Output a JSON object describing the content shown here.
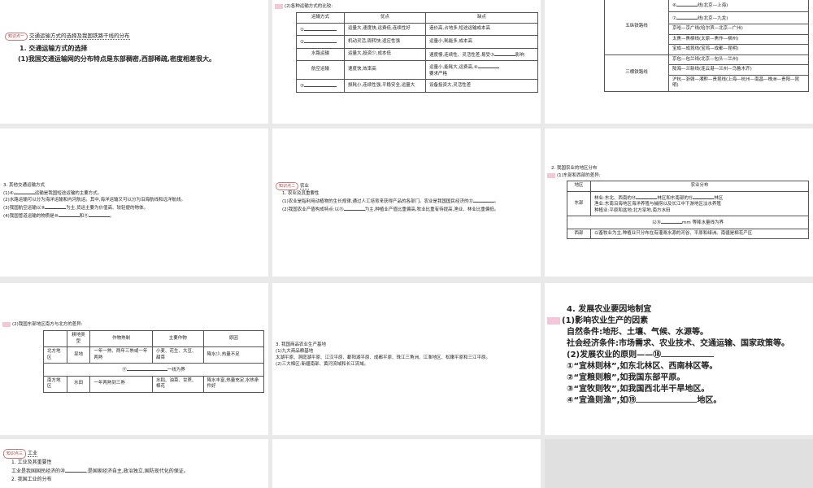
{
  "s1": {
    "tag": "知识点一",
    "title": "交通运输方式的选择及我国铁路干线的分布",
    "h": "1. 交通运输方式的选择",
    "p": "(1)我国交通运输网的分布特点是东部稠密,西部稀疏,密度相差很大。"
  },
  "s2": {
    "cap": "(2)各种运输方式的比较:",
    "head": [
      "运输方式",
      "优点",
      "缺点"
    ],
    "rows": [
      [
        "①",
        "运量大,速度快,运费低,连续性好",
        "造价高,占地多,短途运输成本高"
      ],
      [
        "②",
        "机动灵活,周转快,适应性强",
        "运量小,耗能多,成本高"
      ],
      [
        "水路运输",
        "运量大,投资少,成本低",
        "速度慢,连续性、灵活性差,易受③",
        "影响"
      ],
      [
        "航空运输",
        "速度快,效率高",
        "运量小,能耗大,运费高,④",
        "要求严格"
      ],
      [
        "⑤",
        "损耗小,连续性强,平稳安全,运量大",
        "设备投资大,灵活性差"
      ]
    ]
  },
  "s3": {
    "g1": "五纵铁路线",
    "g2": "三横铁路线",
    "l1": [
      "⑥",
      "线(北京—上海)",
      "⑦",
      "线(北京—九龙)",
      "京哈—京广线(哈尔滨—北京—广州)",
      "太焦—焦柳线(太原—焦作—柳州)",
      "宝成—成昆线(宝鸡—成都—昆明)"
    ],
    "l2": [
      "京包—包兰线(北京—包头—兰州)",
      "陇海—兰新线(连云港—兰州—乌鲁木齐)",
      "沪杭—浙赣—湘黔—贵昆线(上海—杭州—南昌—株洲—贵阳—昆明)"
    ]
  },
  "s4": {
    "h": "3. 其他交通运输方式",
    "l1a": "(1)⑥",
    "l1b": "运输是我国短途运输的主要方式。",
    "l2": "(2)水路运输可以分为海洋运输和内河航运。其中,海洋运输又可以分为沿海航线和远洋航线。",
    "l3a": "(3)我国航空运输以⑨",
    "l3b": "为主,货运主要为价值高、较轻便的物体。",
    "l4a": "(4)我国管道运输的物质是⑩",
    "l4b": "和⑪",
    "l4c": "。"
  },
  "s5": {
    "tag": "知识点二",
    "title": "农业",
    "h": "1. 农业及其重要性",
    "p1a": "(1)农业是指利用动植物的生长规律,通过人工培育来获得产品的各部门。农业是我国国民经济的⑫",
    "p1b": "。",
    "p2a": "(2)我国农业产值构成特点:以⑬",
    "p2b": "为主,种植业产值比重偏高,牧业比重有待提高,渔业、林业比重偏低。"
  },
  "s6": {
    "h": "2. 我国农业的地区分布",
    "cap": "(1)东部和西部的差异:",
    "head": [
      "地区",
      "农业分布"
    ],
    "east": "东部",
    "e1a": "林业:东北、西南的⑭",
    "e1b": "林区和东南部的⑮",
    "e1c": "林区",
    "e2": "渔业:东南沿海地区海洋养殖与捕捞以及长江中下游地区淡水养殖",
    "e3": "种植业:平原和盆地;北方旱地,南方水田",
    "divA": "以⑯",
    "divB": "mm 等降水量线为界",
    "west": "西部",
    "w": "以畜牧业为主,种植业只分布在有灌溉水源的河谷、平原和绿洲。南疆是棉花产区"
  },
  "s7": {
    "cap": "(2)我国东部地区南方与北方的差异:",
    "head": [
      "",
      "耕地类型",
      "作物熟制",
      "主要作物",
      "原因"
    ],
    "north": [
      "北方地区",
      "旱地",
      "一年一熟、两年三熟或一年两熟",
      "小麦、花生、大豆、甜菜",
      "降水少,热量不足"
    ],
    "divA": "⑰",
    "divB": "一线为界",
    "south": [
      "南方地区",
      "水田",
      "一年两熟到三熟",
      "水稻、油菜、甘蔗、棉花",
      "降水丰富,热量充足,水热条件好"
    ]
  },
  "s8": {
    "h": "3. 我国商品农业生产基地",
    "l1": "(1)九大商品粮基地",
    "l2": "太湖平原、洞庭湖平原、江汉平原、鄱阳湖平原、成都平原、珠江三角洲、江淮地区、松嫩平原和三江平原。",
    "l3": "(2)三大棉区:新疆南部、黄河流域和长江流域。"
  },
  "s9": {
    "h": "4. 发展农业要因地制宜",
    "p1": "(1)影响农业生产的因素",
    "p2": "自然条件:地形、土壤、气候、水源等。",
    "p3": "社会经济条件:市场需求、农业技术、交通运输、国家政策等。",
    "p4": "(2)发展农业的原则——⑱",
    "p5": "①“宜林则林”,如东北林区、西南林区等。",
    "p6": "②“宜粮则粮”,如我国东部平原。",
    "p7": "③“宜牧则牧”,如我国西北半干旱地区。",
    "p8a": "④“宜渔则渔”,如⑲",
    "p8b": "地区。"
  },
  "s10": {
    "tag": "知识点三",
    "title": "工业",
    "h": "1. 工业及其重要性",
    "pa": "工业是我国国民经济的⑳",
    "pb": ",是国家经济自主,政治独立,国防现代化的保证。",
    "h2": "2. 我国工业的分布"
  }
}
